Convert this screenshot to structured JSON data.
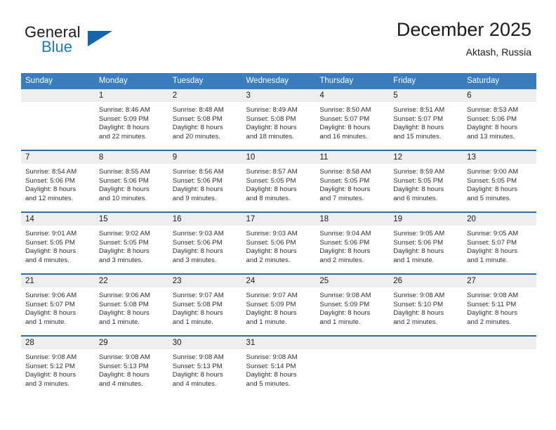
{
  "brand": {
    "name_part1": "General",
    "name_part2": "Blue",
    "triangle_color": "#1565ae",
    "blue_color": "#1a79c8"
  },
  "header": {
    "month_title": "December 2025",
    "location": "Aktash, Russia"
  },
  "theme": {
    "header_row_bg": "#3a7cbe",
    "row_divider": "#2b6ca9",
    "daynum_band_bg": "#eeeeee",
    "page_bg": "#ffffff"
  },
  "weekdays": [
    "Sunday",
    "Monday",
    "Tuesday",
    "Wednesday",
    "Thursday",
    "Friday",
    "Saturday"
  ],
  "weeks": [
    [
      {
        "day": "",
        "lines": []
      },
      {
        "day": "1",
        "lines": [
          "Sunrise: 8:46 AM",
          "Sunset: 5:09 PM",
          "Daylight: 8 hours",
          "and 22 minutes."
        ]
      },
      {
        "day": "2",
        "lines": [
          "Sunrise: 8:48 AM",
          "Sunset: 5:08 PM",
          "Daylight: 8 hours",
          "and 20 minutes."
        ]
      },
      {
        "day": "3",
        "lines": [
          "Sunrise: 8:49 AM",
          "Sunset: 5:08 PM",
          "Daylight: 8 hours",
          "and 18 minutes."
        ]
      },
      {
        "day": "4",
        "lines": [
          "Sunrise: 8:50 AM",
          "Sunset: 5:07 PM",
          "Daylight: 8 hours",
          "and 16 minutes."
        ]
      },
      {
        "day": "5",
        "lines": [
          "Sunrise: 8:51 AM",
          "Sunset: 5:07 PM",
          "Daylight: 8 hours",
          "and 15 minutes."
        ]
      },
      {
        "day": "6",
        "lines": [
          "Sunrise: 8:53 AM",
          "Sunset: 5:06 PM",
          "Daylight: 8 hours",
          "and 13 minutes."
        ]
      }
    ],
    [
      {
        "day": "7",
        "lines": [
          "Sunrise: 8:54 AM",
          "Sunset: 5:06 PM",
          "Daylight: 8 hours",
          "and 12 minutes."
        ]
      },
      {
        "day": "8",
        "lines": [
          "Sunrise: 8:55 AM",
          "Sunset: 5:06 PM",
          "Daylight: 8 hours",
          "and 10 minutes."
        ]
      },
      {
        "day": "9",
        "lines": [
          "Sunrise: 8:56 AM",
          "Sunset: 5:06 PM",
          "Daylight: 8 hours",
          "and 9 minutes."
        ]
      },
      {
        "day": "10",
        "lines": [
          "Sunrise: 8:57 AM",
          "Sunset: 5:05 PM",
          "Daylight: 8 hours",
          "and 8 minutes."
        ]
      },
      {
        "day": "11",
        "lines": [
          "Sunrise: 8:58 AM",
          "Sunset: 5:05 PM",
          "Daylight: 8 hours",
          "and 7 minutes."
        ]
      },
      {
        "day": "12",
        "lines": [
          "Sunrise: 8:59 AM",
          "Sunset: 5:05 PM",
          "Daylight: 8 hours",
          "and 6 minutes."
        ]
      },
      {
        "day": "13",
        "lines": [
          "Sunrise: 9:00 AM",
          "Sunset: 5:05 PM",
          "Daylight: 8 hours",
          "and 5 minutes."
        ]
      }
    ],
    [
      {
        "day": "14",
        "lines": [
          "Sunrise: 9:01 AM",
          "Sunset: 5:05 PM",
          "Daylight: 8 hours",
          "and 4 minutes."
        ]
      },
      {
        "day": "15",
        "lines": [
          "Sunrise: 9:02 AM",
          "Sunset: 5:05 PM",
          "Daylight: 8 hours",
          "and 3 minutes."
        ]
      },
      {
        "day": "16",
        "lines": [
          "Sunrise: 9:03 AM",
          "Sunset: 5:06 PM",
          "Daylight: 8 hours",
          "and 3 minutes."
        ]
      },
      {
        "day": "17",
        "lines": [
          "Sunrise: 9:03 AM",
          "Sunset: 5:06 PM",
          "Daylight: 8 hours",
          "and 2 minutes."
        ]
      },
      {
        "day": "18",
        "lines": [
          "Sunrise: 9:04 AM",
          "Sunset: 5:06 PM",
          "Daylight: 8 hours",
          "and 2 minutes."
        ]
      },
      {
        "day": "19",
        "lines": [
          "Sunrise: 9:05 AM",
          "Sunset: 5:06 PM",
          "Daylight: 8 hours",
          "and 1 minute."
        ]
      },
      {
        "day": "20",
        "lines": [
          "Sunrise: 9:05 AM",
          "Sunset: 5:07 PM",
          "Daylight: 8 hours",
          "and 1 minute."
        ]
      }
    ],
    [
      {
        "day": "21",
        "lines": [
          "Sunrise: 9:06 AM",
          "Sunset: 5:07 PM",
          "Daylight: 8 hours",
          "and 1 minute."
        ]
      },
      {
        "day": "22",
        "lines": [
          "Sunrise: 9:06 AM",
          "Sunset: 5:08 PM",
          "Daylight: 8 hours",
          "and 1 minute."
        ]
      },
      {
        "day": "23",
        "lines": [
          "Sunrise: 9:07 AM",
          "Sunset: 5:08 PM",
          "Daylight: 8 hours",
          "and 1 minute."
        ]
      },
      {
        "day": "24",
        "lines": [
          "Sunrise: 9:07 AM",
          "Sunset: 5:09 PM",
          "Daylight: 8 hours",
          "and 1 minute."
        ]
      },
      {
        "day": "25",
        "lines": [
          "Sunrise: 9:08 AM",
          "Sunset: 5:09 PM",
          "Daylight: 8 hours",
          "and 1 minute."
        ]
      },
      {
        "day": "26",
        "lines": [
          "Sunrise: 9:08 AM",
          "Sunset: 5:10 PM",
          "Daylight: 8 hours",
          "and 2 minutes."
        ]
      },
      {
        "day": "27",
        "lines": [
          "Sunrise: 9:08 AM",
          "Sunset: 5:11 PM",
          "Daylight: 8 hours",
          "and 2 minutes."
        ]
      }
    ],
    [
      {
        "day": "28",
        "lines": [
          "Sunrise: 9:08 AM",
          "Sunset: 5:12 PM",
          "Daylight: 8 hours",
          "and 3 minutes."
        ]
      },
      {
        "day": "29",
        "lines": [
          "Sunrise: 9:08 AM",
          "Sunset: 5:13 PM",
          "Daylight: 8 hours",
          "and 4 minutes."
        ]
      },
      {
        "day": "30",
        "lines": [
          "Sunrise: 9:08 AM",
          "Sunset: 5:13 PM",
          "Daylight: 8 hours",
          "and 4 minutes."
        ]
      },
      {
        "day": "31",
        "lines": [
          "Sunrise: 9:08 AM",
          "Sunset: 5:14 PM",
          "Daylight: 8 hours",
          "and 5 minutes."
        ]
      },
      {
        "day": "",
        "lines": []
      },
      {
        "day": "",
        "lines": []
      },
      {
        "day": "",
        "lines": []
      }
    ]
  ]
}
